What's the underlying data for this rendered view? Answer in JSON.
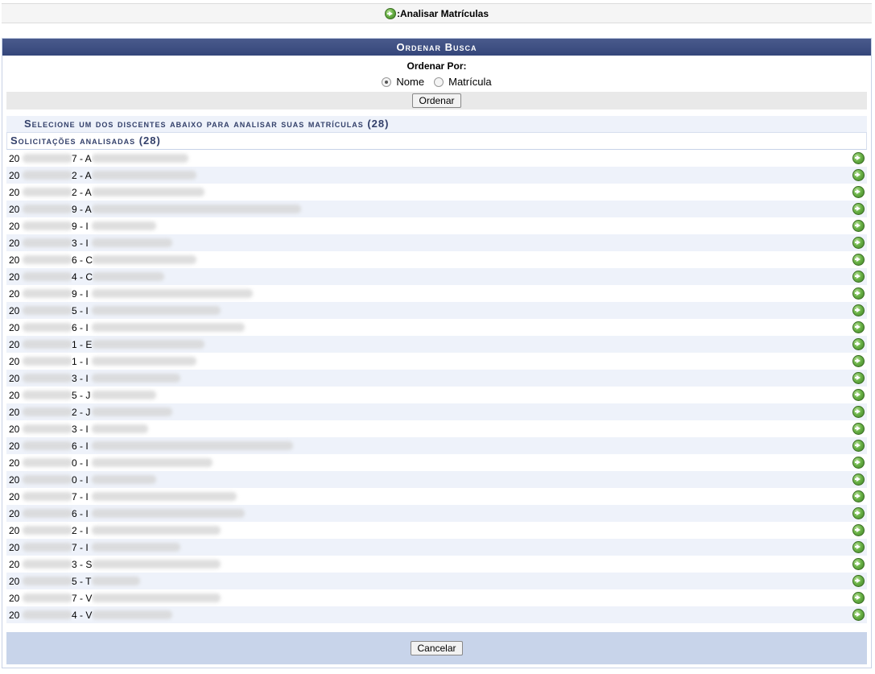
{
  "title": ":Analisar Matrículas",
  "panel": {
    "header": "Ordenar Busca",
    "order_label": "Ordenar Por:",
    "option_nome": "Nome",
    "option_matricula": "Matrícula",
    "selected": "Nome",
    "order_button": "Ordenar"
  },
  "list": {
    "caption": "Selecione um dos discentes abaixo para analisar suas matrículas (28)",
    "sub_caption": "Solicitações analisadas (28)",
    "rows": [
      "20",
      "20",
      "20",
      "20",
      "20",
      "20",
      "20",
      "20",
      "20",
      "20",
      "20",
      "20",
      "20",
      "20",
      "20",
      "20",
      "20",
      "20",
      "20",
      "20",
      "20",
      "20",
      "20",
      "20",
      "20",
      "20",
      "20",
      "20"
    ],
    "row_suffixes": [
      "7 - A",
      "2 - A",
      "2 - A",
      "9 - A",
      "9 - I",
      "3 - I",
      "6 - C",
      "4 - C",
      "9 - I",
      "5 - I",
      "6 - I",
      "1 - E",
      "1 - I",
      "3 - I",
      "5 - J",
      "2 - J",
      "3 - I",
      "6 - I",
      "0 - I",
      "0 - I",
      "7 - I",
      "6 - I",
      "2 - I",
      "7 - I",
      "3 - S",
      "5 - T",
      "7 - V",
      "4 - V"
    ]
  },
  "cancel_button": "Cancelar"
}
